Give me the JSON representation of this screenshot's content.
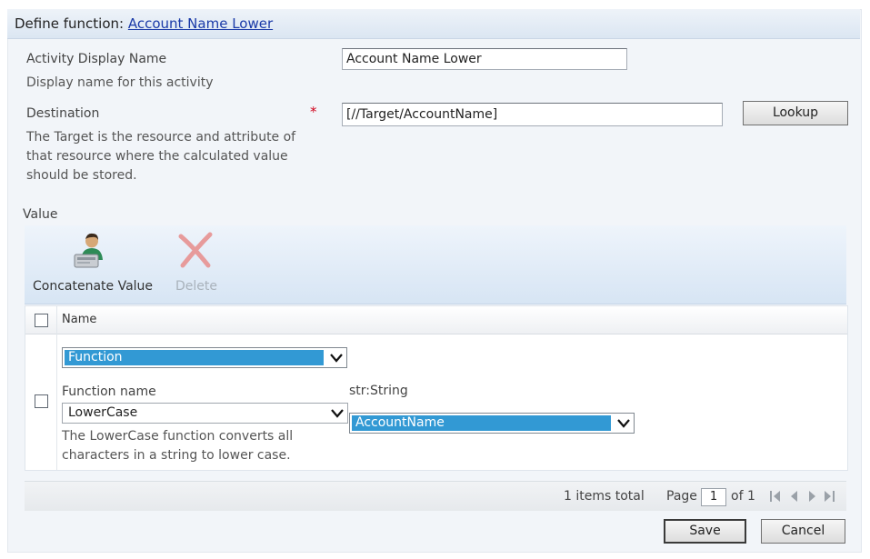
{
  "header": {
    "title_prefix": "Define function:",
    "title_link": "Account Name Lower"
  },
  "fields": {
    "display_name": {
      "label": "Activity Display Name",
      "description": "Display name for this activity",
      "value": "Account Name Lower"
    },
    "destination": {
      "label": "Destination",
      "required_marker": "*",
      "description": "The Target is the resource and attribute of that resource where the calculated value should be stored.",
      "value": "[//Target/AccountName]",
      "lookup_label": "Lookup"
    }
  },
  "value_section": {
    "label": "Value",
    "toolbar": {
      "concatenate_label": "Concatenate Value",
      "delete_label": "Delete"
    },
    "grid": {
      "column_name": "Name",
      "row": {
        "type_select": "Function",
        "function_name_label": "Function name",
        "function_select": "LowerCase",
        "function_description": "The LowerCase function converts all characters in a string to lower case.",
        "param_type": "str:String",
        "param_select": "AccountName"
      }
    },
    "pager": {
      "items_total": "1 items total",
      "page_label": "Page",
      "page_value": "1",
      "of_label": "of 1"
    }
  },
  "actions": {
    "save_label": "Save",
    "cancel_label": "Cancel"
  },
  "colors": {
    "link": "#1a3aa8",
    "required": "#d0021b",
    "selection": "#3299d4",
    "toolbar_bg": "#d7e5f4"
  }
}
